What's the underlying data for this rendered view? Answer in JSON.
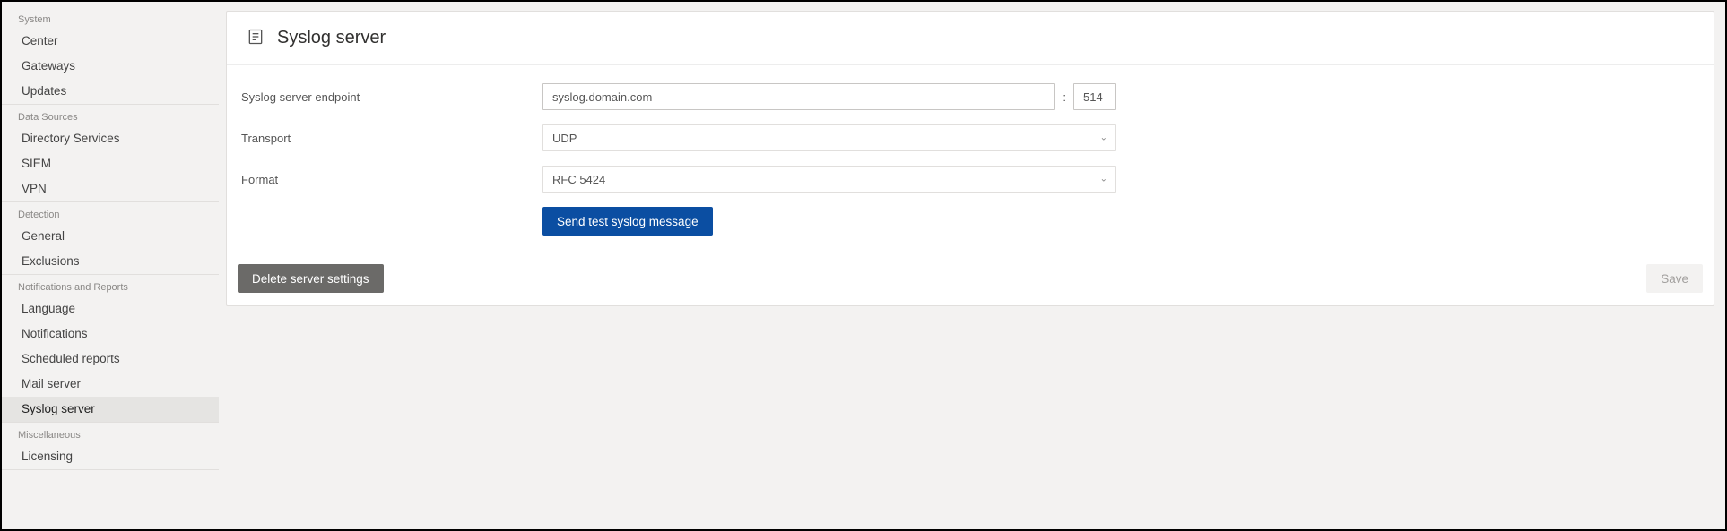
{
  "sidebar": {
    "groups": [
      {
        "header": "System",
        "items": [
          {
            "label": "Center",
            "active": false
          },
          {
            "label": "Gateways",
            "active": false
          },
          {
            "label": "Updates",
            "active": false
          }
        ]
      },
      {
        "header": "Data Sources",
        "items": [
          {
            "label": "Directory Services",
            "active": false
          },
          {
            "label": "SIEM",
            "active": false
          },
          {
            "label": "VPN",
            "active": false
          }
        ]
      },
      {
        "header": "Detection",
        "items": [
          {
            "label": "General",
            "active": false
          },
          {
            "label": "Exclusions",
            "active": false
          }
        ]
      },
      {
        "header": "Notifications and Reports",
        "items": [
          {
            "label": "Language",
            "active": false
          },
          {
            "label": "Notifications",
            "active": false
          },
          {
            "label": "Scheduled reports",
            "active": false
          },
          {
            "label": "Mail server",
            "active": false
          },
          {
            "label": "Syslog server",
            "active": true
          }
        ]
      },
      {
        "header": "Miscellaneous",
        "items": [
          {
            "label": "Licensing",
            "active": false
          }
        ]
      }
    ]
  },
  "page": {
    "title": "Syslog server",
    "form": {
      "endpoint_label": "Syslog server endpoint",
      "endpoint_host": "syslog.domain.com",
      "endpoint_separator": ":",
      "endpoint_port": "514",
      "transport_label": "Transport",
      "transport_value": "UDP",
      "format_label": "Format",
      "format_value": "RFC 5424",
      "send_test_label": "Send test syslog message"
    },
    "footer": {
      "delete_label": "Delete server settings",
      "save_label": "Save"
    }
  }
}
